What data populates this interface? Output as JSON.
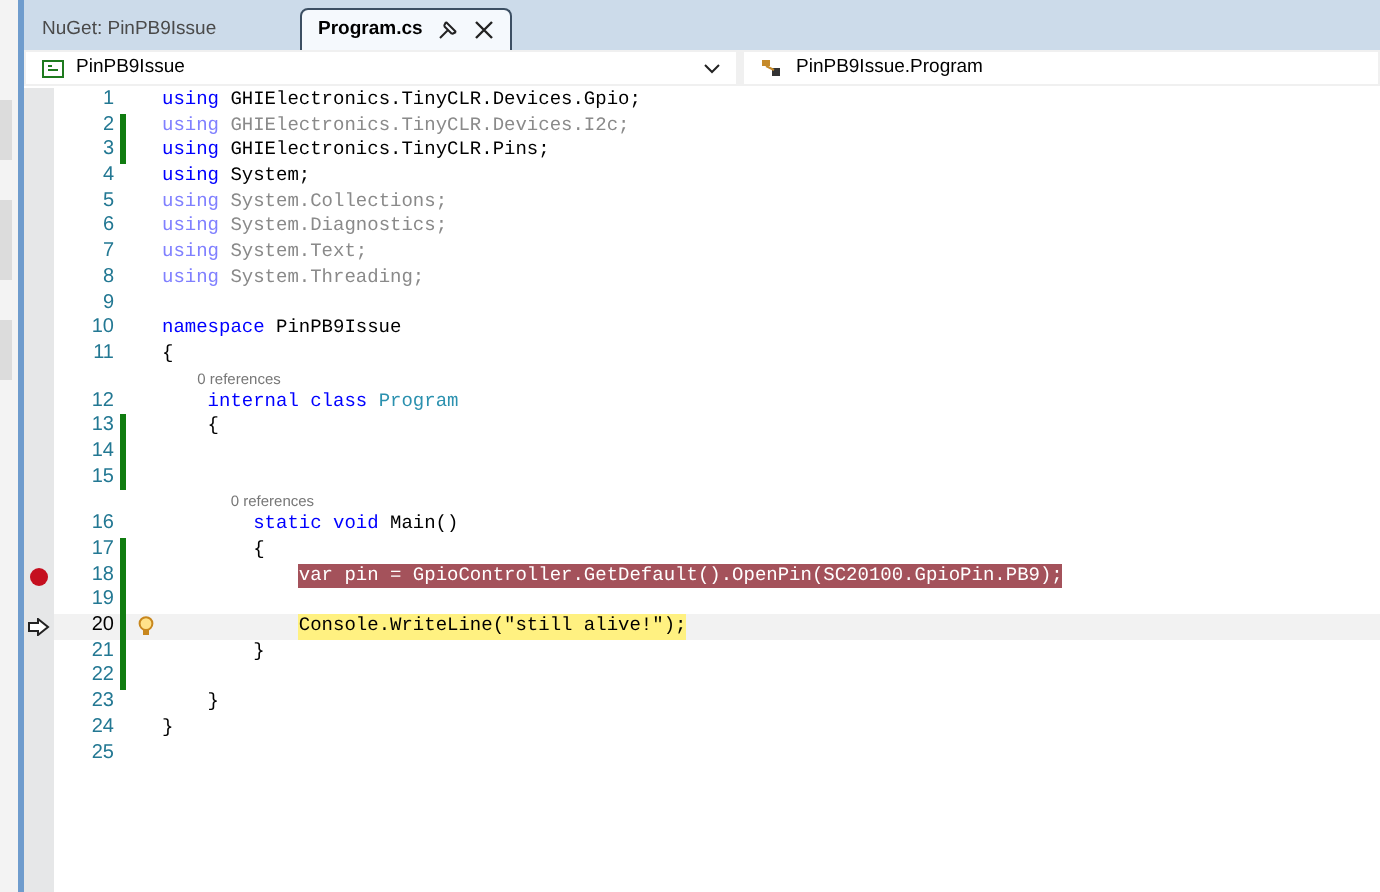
{
  "tabs": [
    {
      "label": "NuGet: PinPB9Issue",
      "selected": false
    },
    {
      "label": "Program.cs",
      "selected": true
    }
  ],
  "nav": {
    "project": "PinPB9Issue",
    "member": "PinPB9Issue.Program"
  },
  "lines": [
    {
      "number": "1",
      "changed": false,
      "tokens": [
        {
          "text": "using",
          "kind": "keyword"
        },
        {
          "text": " GHIElectronics.TinyCLR.Devices.Gpio;",
          "kind": "plain"
        }
      ]
    },
    {
      "number": "2",
      "changed": true,
      "tokens": [
        {
          "text": "using",
          "kind": "dimkeyword"
        },
        {
          "text": " GHIElectronics.TinyCLR.Devices.I2c;",
          "kind": "dim"
        }
      ]
    },
    {
      "number": "3",
      "changed": true,
      "tokens": [
        {
          "text": "using",
          "kind": "keyword"
        },
        {
          "text": " GHIElectronics.TinyCLR.Pins;",
          "kind": "plain"
        }
      ]
    },
    {
      "number": "4",
      "changed": false,
      "tokens": [
        {
          "text": "using",
          "kind": "keyword"
        },
        {
          "text": " System;",
          "kind": "plain"
        }
      ]
    },
    {
      "number": "5",
      "changed": false,
      "tokens": [
        {
          "text": "using",
          "kind": "dimkeyword"
        },
        {
          "text": " System.Collections;",
          "kind": "dim"
        }
      ]
    },
    {
      "number": "6",
      "changed": false,
      "tokens": [
        {
          "text": "using",
          "kind": "dimkeyword"
        },
        {
          "text": " System.Diagnostics;",
          "kind": "dim"
        }
      ]
    },
    {
      "number": "7",
      "changed": false,
      "tokens": [
        {
          "text": "using",
          "kind": "dimkeyword"
        },
        {
          "text": " System.Text;",
          "kind": "dim"
        }
      ]
    },
    {
      "number": "8",
      "changed": false,
      "tokens": [
        {
          "text": "using",
          "kind": "dimkeyword"
        },
        {
          "text": " System.Threading;",
          "kind": "dim"
        }
      ]
    },
    {
      "number": "9",
      "changed": false
    },
    {
      "number": "10",
      "changed": false,
      "tokens": [
        {
          "text": "namespace",
          "kind": "keyword"
        },
        {
          "text": " PinPB9Issue",
          "kind": "plain"
        }
      ]
    },
    {
      "number": "11",
      "changed": false,
      "tokens": [
        {
          "text": "{",
          "kind": "plain"
        }
      ]
    },
    {
      "number": "12",
      "changed": false,
      "codelens": "0 references",
      "tokens": [
        {
          "text": "    internal class ",
          "kind": "keyword"
        },
        {
          "text": "Program",
          "kind": "type"
        }
      ]
    },
    {
      "number": "13",
      "changed": true,
      "tokens": [
        {
          "text": "    {",
          "kind": "plain"
        }
      ]
    },
    {
      "number": "14",
      "changed": true
    },
    {
      "number": "15",
      "changed": true
    },
    {
      "number": "16",
      "changed": false,
      "codelens": "0 references",
      "tokens": [
        {
          "text": "        static void",
          "kind": "keyword"
        },
        {
          "text": " Main()",
          "kind": "plain"
        }
      ]
    },
    {
      "number": "17",
      "changed": true,
      "tokens": [
        {
          "text": "        {",
          "kind": "plain"
        }
      ]
    },
    {
      "number": "18",
      "changed": true,
      "breakpoint": true,
      "tokens": [
        {
          "text": "            var pin = GpioController.GetDefault().OpenPin(SC20100.GpioPin.PB9);",
          "kind": "breakpoint"
        }
      ]
    },
    {
      "number": "19",
      "changed": true
    },
    {
      "number": "20",
      "changed": true,
      "current": true,
      "lightbulb": true,
      "tokens": [
        {
          "text": "            Console.WriteLine(\"still alive!\");",
          "kind": "current"
        }
      ]
    },
    {
      "number": "21",
      "changed": true,
      "tokens": [
        {
          "text": "        }",
          "kind": "plain"
        }
      ]
    },
    {
      "number": "22",
      "changed": true
    },
    {
      "number": "23",
      "changed": false,
      "tokens": [
        {
          "text": "    }",
          "kind": "plain"
        }
      ]
    },
    {
      "number": "24",
      "changed": false,
      "tokens": [
        {
          "text": "}",
          "kind": "plain"
        }
      ]
    },
    {
      "number": "25",
      "changed": false
    }
  ]
}
